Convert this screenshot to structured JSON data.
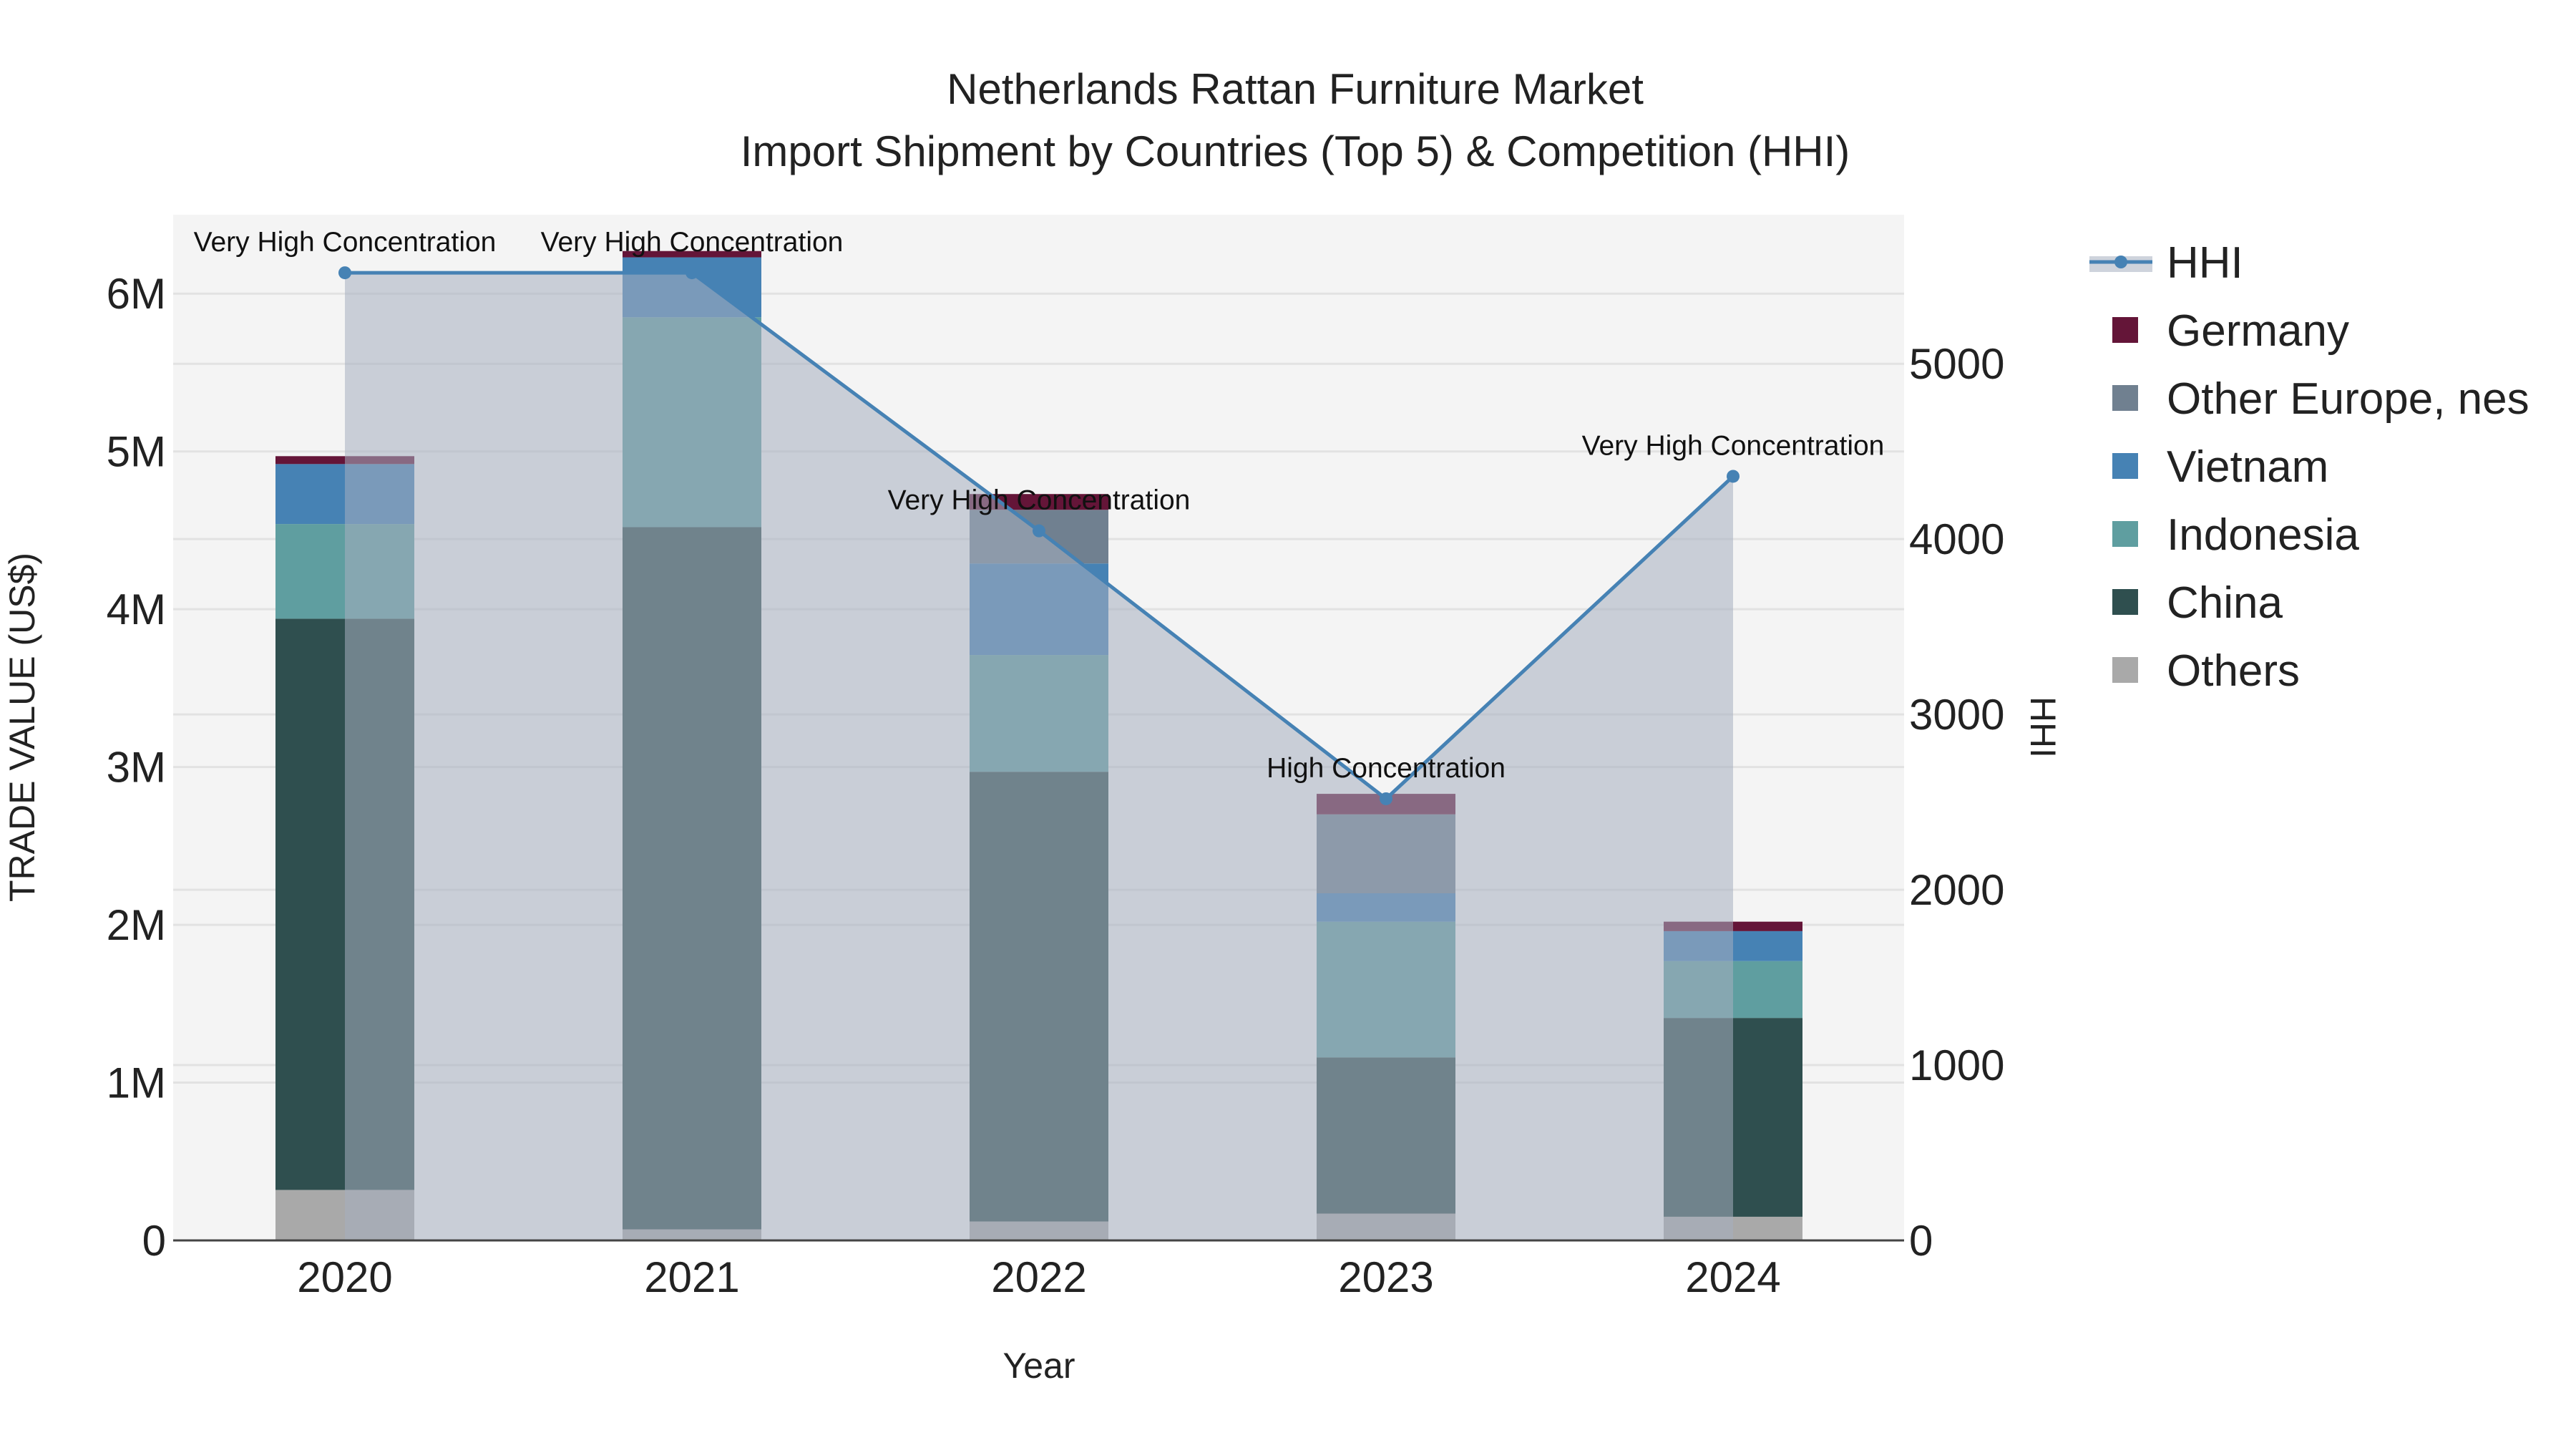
{
  "chart_data": {
    "type": "bar",
    "title": "Netherlands Rattan Furniture Market",
    "subtitle": "Import Shipment by Countries (Top 5) & Competition (HHI)",
    "xlabel": "Year",
    "ylabel": "TRADE VALUE (US$)",
    "y2label": "HHI",
    "categories": [
      "2020",
      "2021",
      "2022",
      "2023",
      "2024"
    ],
    "ylim": [
      0,
      6500000
    ],
    "y2lim": [
      0,
      5850
    ],
    "yticks": [
      {
        "v": 0,
        "label": "0"
      },
      {
        "v": 1000000,
        "label": "1M"
      },
      {
        "v": 2000000,
        "label": "2M"
      },
      {
        "v": 3000000,
        "label": "3M"
      },
      {
        "v": 4000000,
        "label": "4M"
      },
      {
        "v": 5000000,
        "label": "5M"
      },
      {
        "v": 6000000,
        "label": "6M"
      }
    ],
    "y2ticks": [
      {
        "v": 0,
        "label": "0"
      },
      {
        "v": 1000,
        "label": "1000"
      },
      {
        "v": 2000,
        "label": "2000"
      },
      {
        "v": 3000,
        "label": "3000"
      },
      {
        "v": 4000,
        "label": "4000"
      },
      {
        "v": 5000,
        "label": "5000"
      }
    ],
    "stacked": true,
    "series": [
      {
        "name": "Others",
        "color": "#a9a9a9",
        "values": [
          320000,
          70000,
          120000,
          170000,
          150000
        ]
      },
      {
        "name": "China",
        "color": "#2f4f4f",
        "values": [
          3620000,
          4450000,
          2850000,
          990000,
          1260000
        ]
      },
      {
        "name": "Indonesia",
        "color": "#5f9ea0",
        "values": [
          600000,
          1330000,
          740000,
          860000,
          360000
        ]
      },
      {
        "name": "Vietnam",
        "color": "#4682b4",
        "values": [
          380000,
          380000,
          580000,
          180000,
          190000
        ]
      },
      {
        "name": "Other Europe, nes",
        "color": "#708090",
        "values": [
          0,
          0,
          340000,
          500000,
          0
        ]
      },
      {
        "name": "Germany",
        "color": "#641538",
        "values": [
          50000,
          40000,
          100000,
          130000,
          60000
        ]
      }
    ],
    "hhi": {
      "name": "HHI",
      "color": "#4682b4",
      "values": [
        5519,
        5519,
        4047,
        2519,
        4358
      ],
      "annotations": [
        "Very High Concentration",
        "Very High Concentration",
        "Very High Concentration",
        "High Concentration",
        "Very High Concentration"
      ]
    },
    "legend": {
      "placement": "right",
      "order": [
        "HHI",
        "Germany",
        "Other Europe, nes",
        "Vietnam",
        "Indonesia",
        "China",
        "Others"
      ]
    },
    "grid": true
  }
}
